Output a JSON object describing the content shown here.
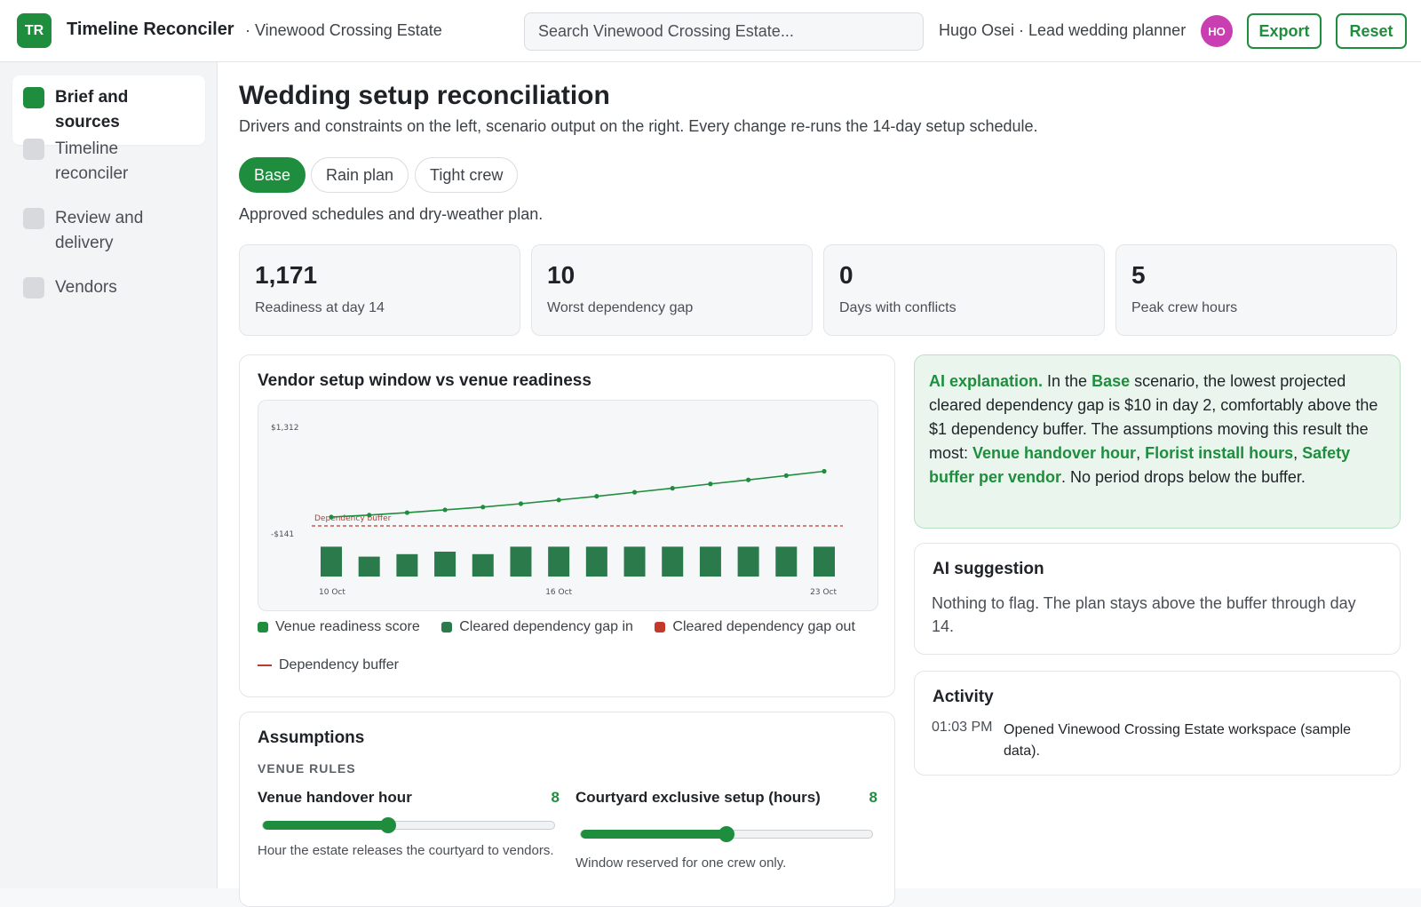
{
  "header": {
    "logo": "TR",
    "app_title": "Timeline Reconciler",
    "workspace": "· Vinewood Crossing Estate",
    "search_placeholder": "Search Vinewood Crossing Estate...",
    "user": "Hugo Osei · Lead wedding planner",
    "avatar_initials": "HO",
    "export_label": "Export",
    "reset_label": "Reset"
  },
  "sidebar": {
    "items": [
      {
        "label": "Brief and sources",
        "active": true
      },
      {
        "label": "Timeline reconciler",
        "active": false
      },
      {
        "label": "Review and delivery",
        "active": false
      },
      {
        "label": "Vendors",
        "active": false
      }
    ]
  },
  "main": {
    "title": "Wedding setup reconciliation",
    "subtitle": "Drivers and constraints on the left, scenario output on the right. Every change re-runs the 14-day setup schedule.",
    "scenarios": [
      "Base",
      "Rain plan",
      "Tight crew"
    ],
    "active_scenario": "Base",
    "scenario_description": "Approved schedules and dry-weather plan.",
    "kpis": [
      {
        "value": "1,171",
        "label": "Readiness at day 14"
      },
      {
        "value": "10",
        "label": "Worst dependency gap"
      },
      {
        "value": "0",
        "label": "Days with conflicts"
      },
      {
        "value": "5",
        "label": "Peak crew hours"
      }
    ]
  },
  "chart_panel": {
    "title": "Vendor setup window vs venue readiness",
    "legend": {
      "readiness": "Venue readiness score",
      "gap_in": "Cleared dependency gap in",
      "gap_out": "Cleared dependency gap out",
      "buffer": "Dependency buffer"
    }
  },
  "chart_data": {
    "type": "line",
    "title": "Vendor setup window vs venue readiness",
    "x_tick_labels": [
      "10 Oct",
      "16 Oct",
      "23 Oct"
    ],
    "y_tick_labels": [
      "$1,312",
      "-$141"
    ],
    "ylim": [
      -141,
      1312
    ],
    "buffer_label": "Dependency buffer",
    "buffer_value": 1,
    "series": [
      {
        "name": "Venue readiness score",
        "kind": "line",
        "color": "#1e8e3e",
        "values": [
          -141,
          -110,
          -70,
          -25,
          20,
          75,
          135,
          195,
          260,
          325,
          395,
          460,
          530,
          600
        ]
      },
      {
        "name": "Cleared dependency gap in",
        "kind": "bar",
        "color": "#2b7a4b",
        "values": [
          12,
          8,
          9,
          10,
          9,
          12,
          12,
          12,
          12,
          12,
          12,
          12,
          12,
          12
        ]
      },
      {
        "name": "Cleared dependency gap out",
        "kind": "bar",
        "color": "#c0392b",
        "values": [
          0,
          0,
          0,
          0,
          0,
          0,
          0,
          0,
          0,
          0,
          0,
          0,
          0,
          0
        ]
      }
    ],
    "grid": false,
    "legend_position": "bottom"
  },
  "assumptions": {
    "title": "Assumptions",
    "section": "VENUE RULES",
    "sliders": [
      {
        "label": "Venue handover hour",
        "value": "8",
        "fraction": 0.43,
        "help": "Hour the estate releases the courtyard to vendors."
      },
      {
        "label": "Courtyard exclusive setup (hours)",
        "value": "8",
        "fraction": 0.5,
        "help": "Window reserved for one crew only."
      }
    ]
  },
  "ai_explanation": {
    "lead": "AI explanation.",
    "t1": " In the ",
    "scenario": "Base",
    "t2": " scenario, the lowest projected cleared dependency gap is $10 in day 2, comfortably above the $1 dependency buffer. The assumptions moving this result the most: ",
    "a1": "Venue handover hour",
    "sep1": ", ",
    "a2": "Florist install hours",
    "sep2": ", ",
    "a3": "Safety buffer per vendor",
    "t3": ". No period drops below the buffer."
  },
  "ai_suggestion": {
    "title": "AI suggestion",
    "text": "Nothing to flag. The plan stays above the buffer through day 14."
  },
  "activity": {
    "title": "Activity",
    "time": "01:03 PM",
    "text": "Opened Vinewood Crossing Estate workspace (sample data)."
  },
  "colors": {
    "accent": "#1e8e3e",
    "avatar": "#c93fb2",
    "danger": "#c0392b"
  }
}
